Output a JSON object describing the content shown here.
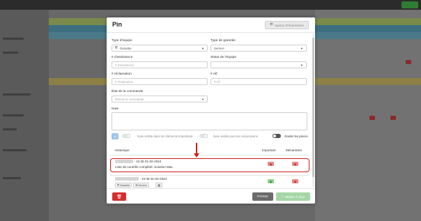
{
  "modal": {
    "title": "Pin",
    "print_label": "Aperçu D'impression"
  },
  "form": {
    "equipment_type": {
      "label": "Type d'équipe",
      "value": "Garantie"
    },
    "warranty_type": {
      "label": "Type de garantie",
      "value": "Service"
    },
    "assistance_number": {
      "label": "# d'assistance",
      "placeholder": "# d'assistance"
    },
    "equipment_status": {
      "label": "Statut de l'équipe",
      "value": ""
    },
    "claim_number": {
      "label": "# réclamation",
      "placeholder": "# réclamation"
    },
    "ref_number": {
      "label": "# réf",
      "placeholder": "# réf"
    },
    "order_status": {
      "label": "État de la commande",
      "placeholder": "État de la commande"
    },
    "note": {
      "label": "Note"
    }
  },
  "toggles": {
    "visible_important": "Note visible dans les éléments importants",
    "visible_mechanics": "Note visible pour les mécaniciens",
    "keep_parts": "Garder les pièces"
  },
  "history": {
    "headers": {
      "history": "Historique",
      "important": "Important",
      "mechanic": "Mécanicien"
    },
    "entries": [
      {
        "timestamp": "- 10:35 01-02-2024",
        "message": "Liste de contrôle complété: Solution Max"
      },
      {
        "timestamp": "- 10:35 01-02-2024",
        "chips": [
          "Garantie",
          "Service"
        ]
      }
    ]
  },
  "footer": {
    "delete_icon": "trash-icon",
    "close_label": "Fermer",
    "update_label": "Mettre À Jour"
  },
  "colors": {
    "danger": "#d32f2f",
    "success": "#a5d6a7",
    "highlight": "#d11b1b"
  }
}
